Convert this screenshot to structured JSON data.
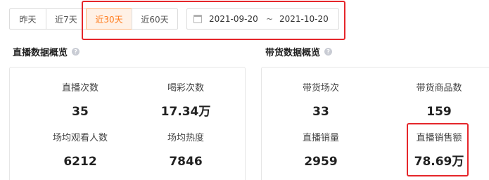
{
  "date_filter": {
    "buttons": [
      "昨天",
      "近7天",
      "近30天",
      "近60天"
    ],
    "active_index": 2,
    "range_start": "2021-09-20",
    "range_separator": "~",
    "range_end": "2021-10-20"
  },
  "live_section": {
    "title": "直播数据概览",
    "metrics": [
      {
        "label": "直播次数",
        "value": "35"
      },
      {
        "label": "喝彩次数",
        "value": "17.34万"
      },
      {
        "label": "场均观看人数",
        "value": "6212"
      },
      {
        "label": "场均热度",
        "value": "7846"
      }
    ]
  },
  "sales_section": {
    "title": "带货数据概览",
    "metrics": [
      {
        "label": "带货场次",
        "value": "33"
      },
      {
        "label": "带货商品数",
        "value": "159"
      },
      {
        "label": "直播销量",
        "value": "2959"
      },
      {
        "label": "直播销售额",
        "value": "78.69万"
      }
    ]
  },
  "colors": {
    "accent": "#ff7a1a",
    "highlight_border": "#e5262b"
  },
  "icons": {
    "calendar": "calendar-icon",
    "help": "help-icon"
  }
}
